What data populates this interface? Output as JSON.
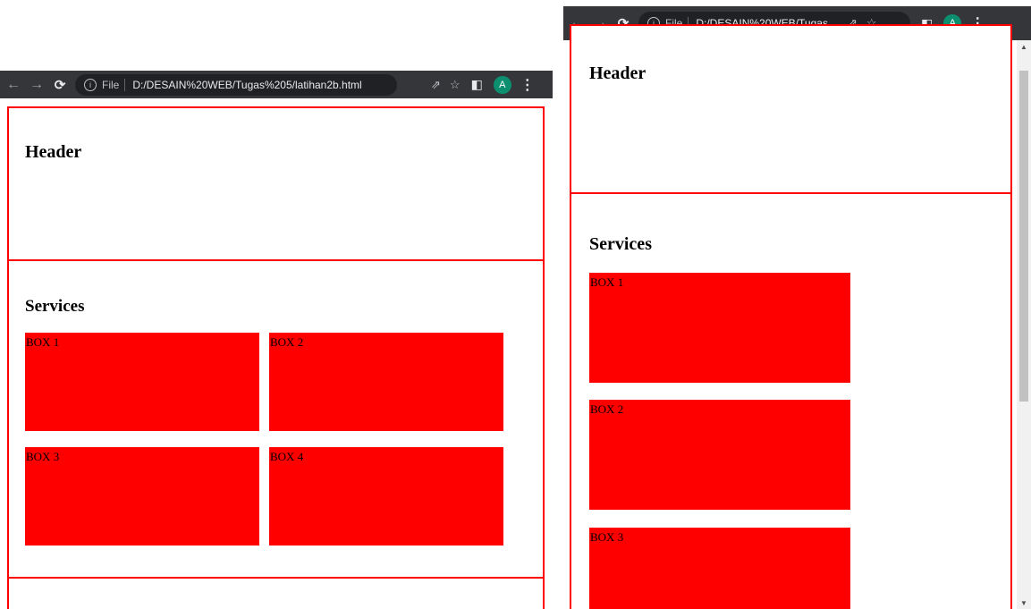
{
  "left_window": {
    "url_file_label": "File",
    "url": "D:/DESAIN%20WEB/Tugas%205/latihan2b.html",
    "avatar_letter": "A",
    "header_title": "Header",
    "services_title": "Services",
    "boxes": [
      "BOX 1",
      "BOX 2",
      "BOX 3",
      "BOX 4"
    ]
  },
  "right_window": {
    "url_file_label": "File",
    "url": "D:/DESAIN%20WEB/Tugas...",
    "avatar_letter": "A",
    "header_title": "Header",
    "services_title": "Services",
    "boxes": [
      "BOX 1",
      "BOX 2",
      "BOX 3"
    ]
  },
  "colors": {
    "toolbar": "#35363a",
    "border": "#ff0000",
    "box_fill": "#ff0000",
    "avatar": "#0b8f6f"
  },
  "icons": [
    "back-arrow-icon",
    "forward-arrow-icon",
    "reload-icon",
    "info-icon",
    "share-icon",
    "star-icon",
    "side-panel-icon",
    "menu-kebab-icon"
  ]
}
